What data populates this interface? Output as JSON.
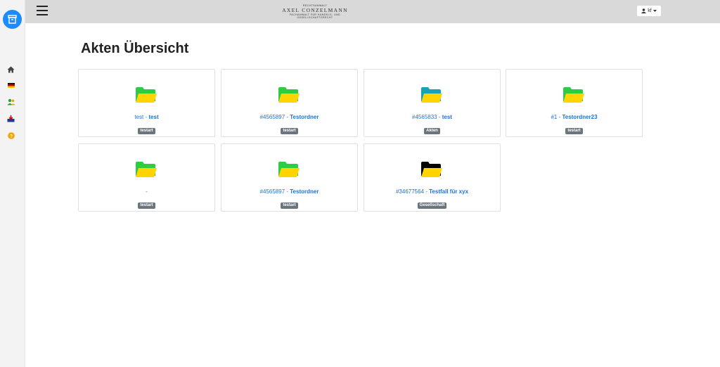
{
  "header": {
    "brand_small": "RECHTSANWALT",
    "brand_name": "AXEL CONZELMANN",
    "brand_sub": "FACHANWALT FÜR HANDELS- UND GESELLSCHAFTSRECHT",
    "user_label": "kf"
  },
  "sidebar": {
    "items": [
      {
        "icon": "home-icon"
      },
      {
        "icon": "flag-de-icon"
      },
      {
        "icon": "users-icon"
      },
      {
        "icon": "inbox-download-icon"
      },
      {
        "icon": "help-icon"
      }
    ]
  },
  "page_title": "Akten Übersicht",
  "cards": [
    {
      "number": "test",
      "sep": " - ",
      "name": "test",
      "badge": "testart",
      "folder_color": "#2ecc40"
    },
    {
      "number": "#4565897",
      "sep": " - ",
      "name": "Testordner",
      "badge": "testart",
      "folder_color": "#2ecc40"
    },
    {
      "number": "#4565833",
      "sep": " - ",
      "name": "test",
      "badge": "Akten",
      "folder_color": "#17a2b8"
    },
    {
      "number": "#1",
      "sep": " - ",
      "name": "Testordner23",
      "badge": "testart",
      "folder_color": "#2ecc40"
    },
    {
      "number": "",
      "sep": "-",
      "name": "",
      "badge": "testart",
      "folder_color": "#2ecc40"
    },
    {
      "number": "#4565897",
      "sep": " - ",
      "name": "Testordner",
      "badge": "testart",
      "folder_color": "#2ecc40"
    },
    {
      "number": "#34677564",
      "sep": " - ",
      "name": "Testfall für xyx",
      "badge": "Gesellschaft",
      "folder_color": "#000000"
    }
  ],
  "colors": {
    "folder_front": "#ffd400",
    "accent": "#1a73d9",
    "badge": "#6c757d"
  }
}
